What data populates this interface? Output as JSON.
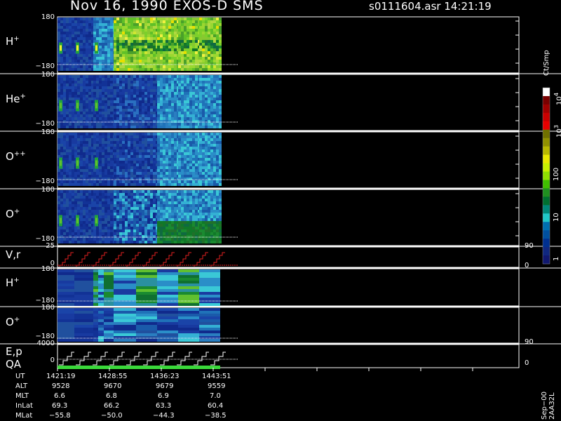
{
  "header": {
    "title": "Nov 16, 1990   EXOS-D SMS",
    "file_info": "s0111604.asr  14:21:19"
  },
  "colors": {
    "background": "#000000",
    "axis": "#ffffff",
    "velocity_trace": "#e02020",
    "qa_bar": "#3ad83a"
  },
  "panels": [
    {
      "id": "h-plus",
      "label": "H",
      "sup": "+",
      "ytop": "180",
      "ybot": "−180"
    },
    {
      "id": "he-plus",
      "label": "He",
      "sup": "+",
      "ytop": "180",
      "ybot": "−180"
    },
    {
      "id": "o-plusplus",
      "label": "O",
      "sup": "++",
      "ytop": "180",
      "ybot": "−180"
    },
    {
      "id": "o-plus",
      "label": "O",
      "sup": "+",
      "ytop": "180",
      "ybot": "−180"
    }
  ],
  "vr_panel": {
    "label": "V,r",
    "ytop": "25",
    "ybot": "0",
    "rtop": "90",
    "rbot": "0"
  },
  "lower_panels": [
    {
      "id": "h-plus-2",
      "label": "H",
      "sup": "+",
      "ytop": "180",
      "ybot": "−180"
    },
    {
      "id": "o-plus-2",
      "label": "O",
      "sup": "+",
      "ytop": "180",
      "ybot": "−180"
    }
  ],
  "ep_panel": {
    "label1": "E,p",
    "label2": "QA",
    "ytop": "4000",
    "ybot": "0",
    "rtop": "90",
    "rbot": "0"
  },
  "colorbar": {
    "unit": "Ct/Smp",
    "tick_labels": [
      "10",
      "100",
      "10",
      "10",
      "1"
    ],
    "tick_sups": [
      "4",
      "",
      "3",
      "",
      ""
    ],
    "colors": [
      "#ffffff",
      "#7a0000",
      "#a00000",
      "#c80000",
      "#e80000",
      "#707000",
      "#909000",
      "#b8b800",
      "#e8e800",
      "#c8f000",
      "#90e000",
      "#40c000",
      "#209020",
      "#007030",
      "#008878",
      "#20c8c8",
      "#0070b0",
      "#0050a0",
      "#003090",
      "#102880",
      "#101870"
    ]
  },
  "ephemeris": {
    "labels": [
      "UT",
      "ALT",
      "MLT",
      "InLat",
      "MLat"
    ],
    "columns": [
      {
        "UT": "1421:19",
        "ALT": "9528",
        "MLT": "6.6",
        "InLat": "69.3",
        "MLat": "−55.8"
      },
      {
        "UT": "1428:55",
        "ALT": "9670",
        "MLT": "6.8",
        "InLat": "66.2",
        "MLat": "−50.0"
      },
      {
        "UT": "1436:23",
        "ALT": "9679",
        "MLT": "6.9",
        "InLat": "63.3",
        "MLat": "−44.3"
      },
      {
        "UT": "1443:51",
        "ALT": "9559",
        "MLT": "7.0",
        "InLat": "60.4",
        "MLat": "−38.5"
      }
    ]
  },
  "side_label": "Sep−00  2AA32L",
  "chart_data": {
    "type": "heatmap",
    "title": "Nov 16, 1990   EXOS-D SMS",
    "x": [
      "1421:19",
      "1428:55",
      "1436:23",
      "1443:51"
    ],
    "panels": [
      "H+",
      "He+",
      "O++",
      "O+",
      "V,r",
      "H+",
      "O+",
      "E,p QA"
    ],
    "ylim_angle": [
      -180,
      180
    ],
    "ylim_velocity": [
      0,
      25
    ],
    "ylim_energy": [
      0,
      4000
    ],
    "colorbar_range_counts": [
      1,
      10000
    ],
    "colorbar_unit": "Ct/Smp",
    "colorbar_scale": "log"
  }
}
